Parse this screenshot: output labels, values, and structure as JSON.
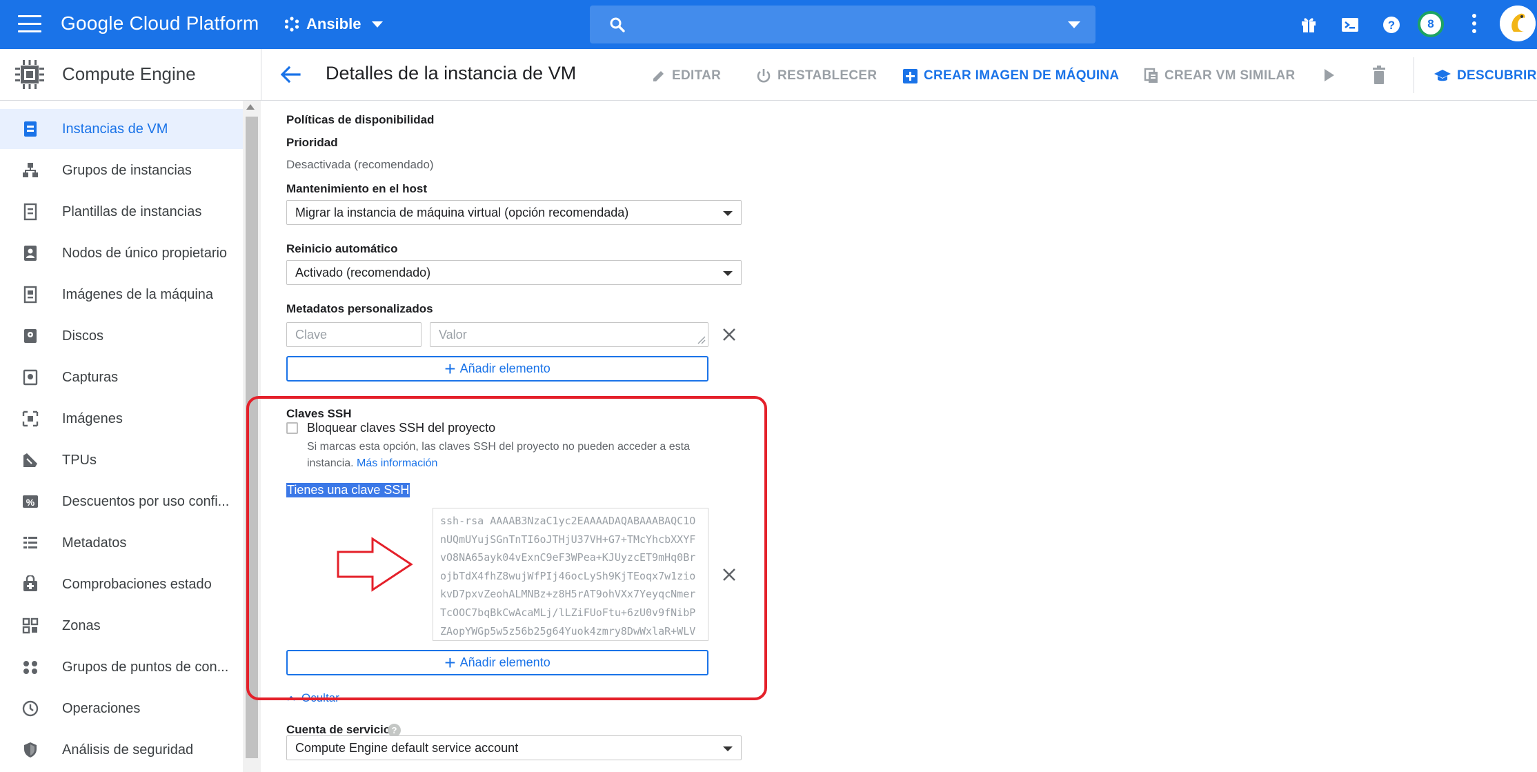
{
  "topbar": {
    "brand": "Google Cloud Platform",
    "project": "Ansible",
    "notifications_count": "8",
    "bg_color": "#1a73e8"
  },
  "subbar": {
    "product": "Compute Engine",
    "page_title": "Detalles de la instancia de VM",
    "actions": {
      "edit": "EDITAR",
      "reset": "RESTABLECER",
      "create_image": "CREAR IMAGEN DE MÁQUINA",
      "create_similar": "CREAR VM SIMILAR",
      "discover": "DESCUBRIR"
    }
  },
  "sidebar": {
    "items": [
      {
        "label": "Instancias de VM",
        "icon": "vm-instances-icon",
        "active": true
      },
      {
        "label": "Grupos de instancias",
        "icon": "instance-groups-icon"
      },
      {
        "label": "Plantillas de instancias",
        "icon": "instance-templates-icon"
      },
      {
        "label": "Nodos de único propietario",
        "icon": "sole-tenant-nodes-icon"
      },
      {
        "label": "Imágenes de la máquina",
        "icon": "machine-images-icon"
      },
      {
        "label": "Discos",
        "icon": "disks-icon"
      },
      {
        "label": "Capturas",
        "icon": "snapshots-icon"
      },
      {
        "label": "Imágenes",
        "icon": "images-icon"
      },
      {
        "label": "TPUs",
        "icon": "tpus-icon"
      },
      {
        "label": "Descuentos por uso confi...",
        "icon": "committed-use-discounts-icon"
      },
      {
        "label": "Metadatos",
        "icon": "metadata-icon"
      },
      {
        "label": "Comprobaciones estado",
        "icon": "health-checks-icon"
      },
      {
        "label": "Zonas",
        "icon": "zones-icon"
      },
      {
        "label": "Grupos de puntos de con...",
        "icon": "network-endpoint-groups-icon"
      },
      {
        "label": "Operaciones",
        "icon": "operations-icon"
      },
      {
        "label": "Análisis de seguridad",
        "icon": "security-scans-icon"
      }
    ]
  },
  "main": {
    "availability_policies": "Políticas de disponibilidad",
    "priority_label": "Prioridad",
    "priority_value": "Desactivada (recomendado)",
    "host_maintenance_label": "Mantenimiento en el host",
    "host_maintenance_value": "Migrar la instancia de máquina virtual (opción recomendada)",
    "auto_restart_label": "Reinicio automático",
    "auto_restart_value": "Activado (recomendado)",
    "custom_metadata_label": "Metadatos personalizados",
    "key_placeholder": "Clave",
    "value_placeholder": "Valor",
    "add_item": "Añadir elemento",
    "ssh_keys_label": "Claves SSH",
    "block_project_keys_label": "Bloquear claves SSH del proyecto",
    "block_project_keys_checked": false,
    "block_help_line1": "Si marcas esta opción, las claves SSH del proyecto no pueden acceder a esta",
    "block_help_line2": "instancia.",
    "more_info": "Más información",
    "ssh_selected_text": "Tienes una clave SSH",
    "ssh_key_lines": [
      "ssh-rsa AAAAB3NzaC1yc2EAAAADAQABAAABAQC1O",
      "nUQmUYujSGnTnTI6oJTHjU37VH+G7+TMcYhcbXXYF",
      "vO8NA65ayk04vExnC9eF3WPea+KJUyzcET9mHq0Br",
      "ojbTdX4fhZ8wujWfPIj46ocLySh9KjTEoqx7w1zio",
      "kvD7pxvZeohALMNBz+z8H5rAT9ohVXx7YeyqcNmer",
      "TcOOC7bqBkCwAcaMLj/lLZiFUoFtu+6zU0v9fNibP",
      "ZAopYWGp5w5z56b25g64Yuok4zmry8DwWxlaR+WLV"
    ],
    "add_item_2": "Añadir elemento",
    "hide_label": "Ocultar",
    "service_account_label": "Cuenta de servicio",
    "service_account_value": "Compute Engine default service account"
  },
  "annotation": {
    "highlight_color": "#e4202a"
  }
}
